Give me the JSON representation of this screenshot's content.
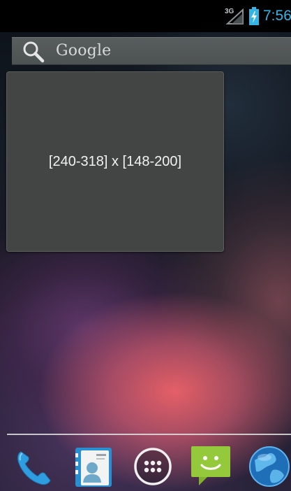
{
  "status_bar": {
    "network_label": "3G",
    "time": "7:56",
    "colors": {
      "accent": "#33b5e5"
    }
  },
  "search": {
    "label": "Google",
    "icon": "search-icon"
  },
  "widget": {
    "text": "[240-318] x [148-200]"
  },
  "dock": {
    "items": [
      {
        "icon": "phone-icon"
      },
      {
        "icon": "contacts-icon"
      },
      {
        "icon": "app-drawer-icon"
      },
      {
        "icon": "messaging-icon"
      },
      {
        "icon": "browser-globe-icon"
      }
    ]
  }
}
